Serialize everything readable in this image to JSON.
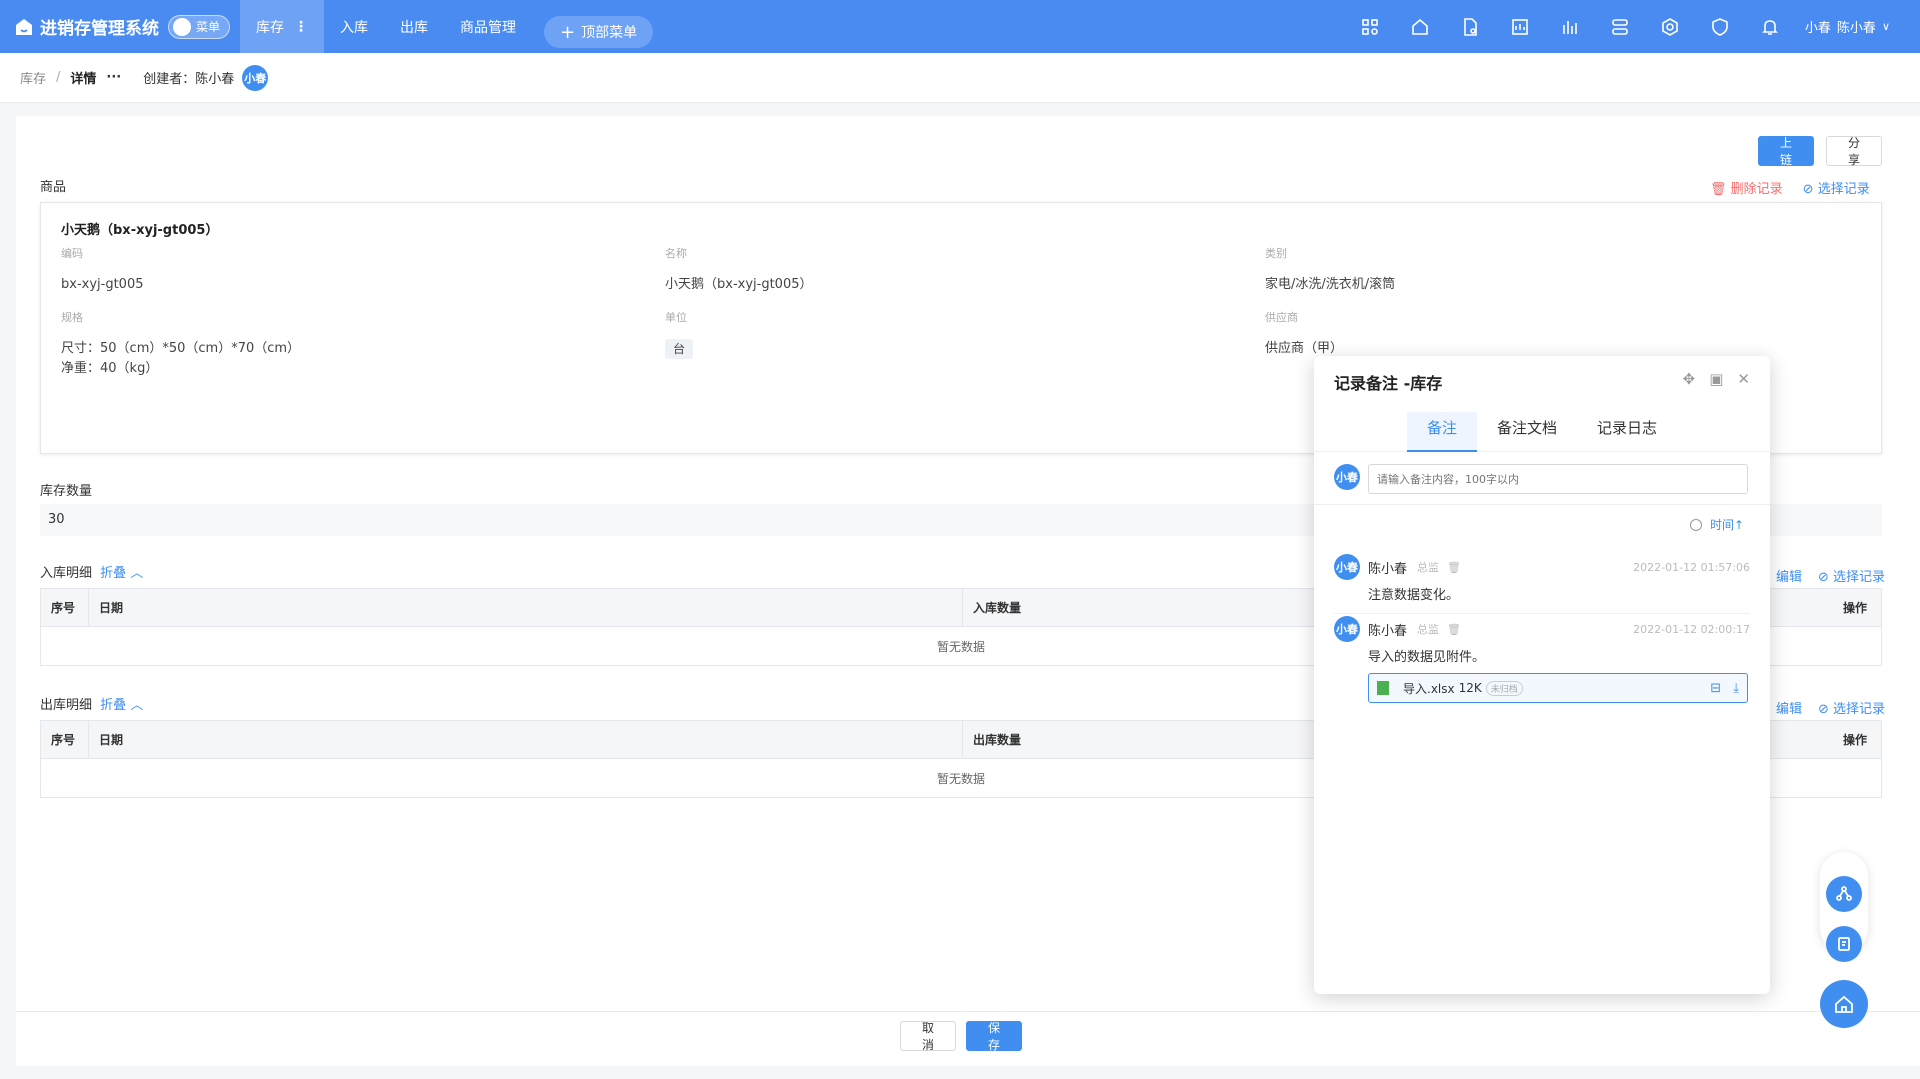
{
  "app": {
    "title": "进销存管理系统",
    "menu_toggle": "菜单"
  },
  "topnav": [
    {
      "label": "库存",
      "active": true
    },
    {
      "label": "入库"
    },
    {
      "label": "出库"
    },
    {
      "label": "商品管理"
    }
  ],
  "top_menu_button": "顶部菜单",
  "top_icons": [
    "apps-icon",
    "home-icon",
    "document-settings-icon",
    "report-icon",
    "chart-icon",
    "server-icon",
    "settings-icon",
    "shield-icon",
    "bell-icon"
  ],
  "user": {
    "avatar": "小春",
    "name": "陈小春"
  },
  "breadcrumb": {
    "parent": "库存",
    "current": "详情",
    "more": "···",
    "creator_label": "创建者：陈小春",
    "creator_avatar": "小春"
  },
  "actions": {
    "chain": "上链",
    "share": "分享",
    "cancel": "取消",
    "save": "保存"
  },
  "goods": {
    "section_label": "商品",
    "delete_link": "删除记录",
    "select_link": "选择记录",
    "title": "小天鹅（bx-xyj-gt005）",
    "fields": {
      "code_label": "编码",
      "code": "bx-xyj-gt005",
      "name_label": "名称",
      "name": "小天鹅（bx-xyj-gt005）",
      "category_label": "类别",
      "category": "家电/冰洗/洗衣机/滚筒",
      "spec_label": "规格",
      "spec_line1": "尺寸：50（cm）*50（cm）*70（cm）",
      "spec_line2": "净重：40（kg）",
      "unit_label": "单位",
      "unit": "台",
      "supplier_label": "供应商",
      "supplier": "供应商（甲）"
    }
  },
  "stock": {
    "label": "库存数量",
    "value": "30"
  },
  "inbound": {
    "label": "入库明细",
    "collapse": "折叠",
    "edit": "编辑",
    "select": "选择记录",
    "columns": [
      "序号",
      "日期",
      "入库数量",
      "操作"
    ],
    "empty": "暂无数据"
  },
  "outbound": {
    "label": "出库明细",
    "collapse": "折叠",
    "edit": "编辑",
    "select": "选择记录",
    "columns": [
      "序号",
      "日期",
      "出库数量",
      "操作"
    ],
    "empty": "暂无数据"
  },
  "notes_panel": {
    "title": "记录备注 -库存",
    "tabs": [
      "备注",
      "备注文档",
      "记录日志"
    ],
    "input_avatar": "小春",
    "input_placeholder": "请输入备注内容，100字以内",
    "time_filter": "时间↑",
    "notes": [
      {
        "avatar": "小春",
        "author": "陈小春",
        "role": "总监",
        "time": "2022-01-12 01:57:06",
        "text": "注意数据变化。"
      },
      {
        "avatar": "小春",
        "author": "陈小春",
        "role": "总监",
        "time": "2022-01-12 02:00:17",
        "text": "导入的数据见附件。",
        "attachment": {
          "name": "导入.xlsx",
          "size": "12K",
          "badge": "未归档"
        }
      }
    ]
  },
  "colors": {
    "primary": "#3f8ef0",
    "topbar": "#4a8bf2",
    "danger": "#f56c6c"
  }
}
